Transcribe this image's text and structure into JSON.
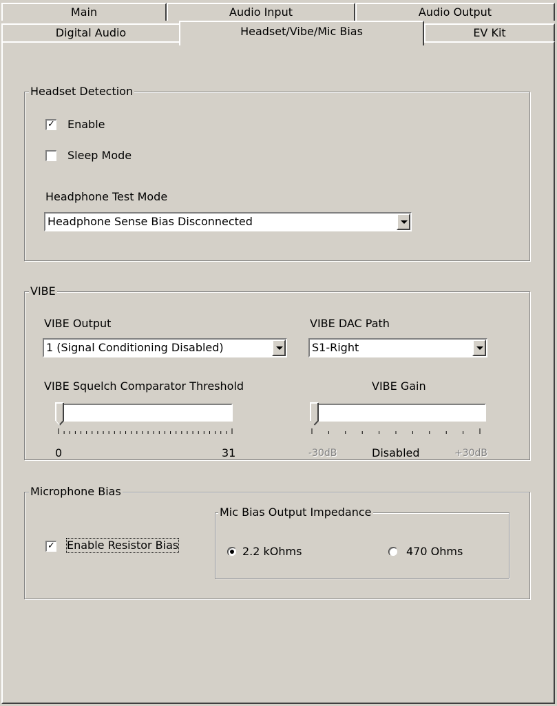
{
  "tabs": {
    "row_back": [
      "Main",
      "Audio Input",
      "Audio Output"
    ],
    "row_front": [
      "Digital Audio",
      "Headset/Vibe/Mic Bias",
      "EV Kit"
    ],
    "selected": "Headset/Vibe/Mic Bias"
  },
  "headset": {
    "title": "Headset Detection",
    "enable_label": "Enable",
    "enable_checked": true,
    "sleep_label": "Sleep Mode",
    "sleep_checked": false,
    "test_mode_label": "Headphone Test Mode",
    "test_mode_value": "Headphone Sense Bias Disconnected"
  },
  "vibe": {
    "title": "VIBE",
    "output_label": "VIBE Output",
    "output_value": "1 (Signal Conditioning Disabled)",
    "dac_label": "VIBE DAC Path",
    "dac_value": "S1-Right",
    "squelch_label": "VIBE Squelch Comparator Threshold",
    "squelch_value": 0,
    "squelch_min": "0",
    "squelch_max": "31",
    "gain_label": "VIBE Gain",
    "gain_min": "-30dB",
    "gain_value": "Disabled",
    "gain_max": "+30dB"
  },
  "mic": {
    "title": "Microphone Bias",
    "enable_label": "Enable Resistor Bias",
    "enable_checked": true,
    "impedance_title": "Mic Bias Output Impedance",
    "option1": "2.2 kOhms",
    "option2": "470 Ohms",
    "selected": "2.2 kOhms"
  },
  "icons": {
    "check": "✓",
    "dropdown": "chevron-down"
  }
}
